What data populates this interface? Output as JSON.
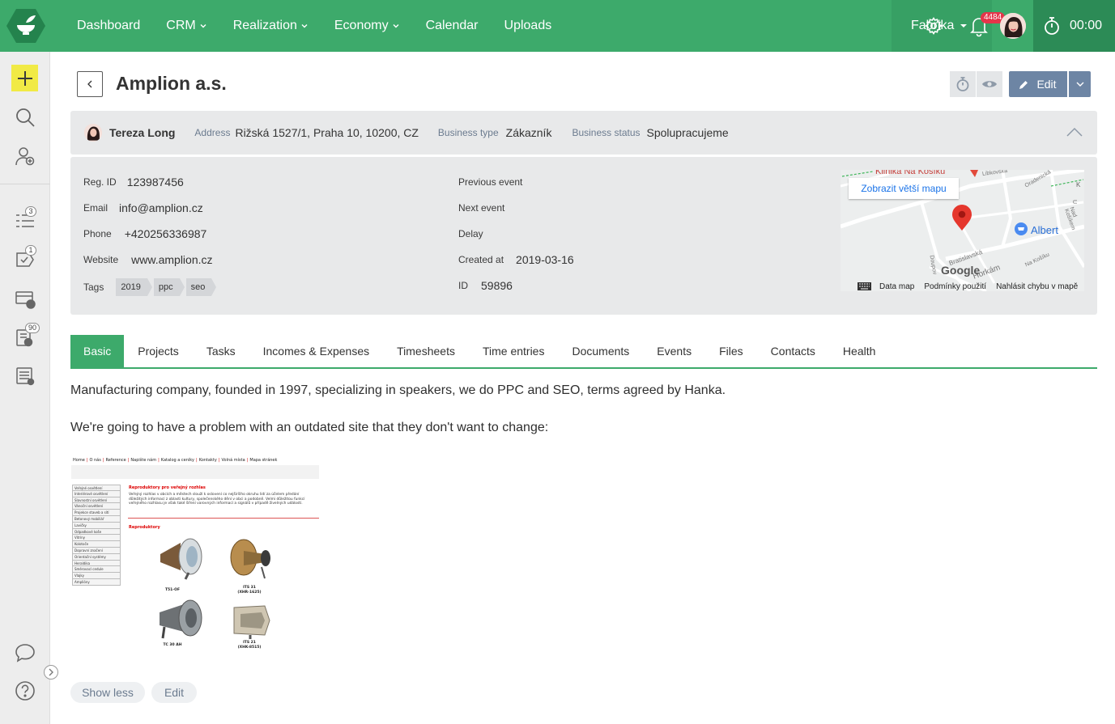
{
  "topbar": {
    "nav": [
      {
        "label": "Dashboard",
        "dropdown": false
      },
      {
        "label": "CRM",
        "dropdown": true
      },
      {
        "label": "Realization",
        "dropdown": true
      },
      {
        "label": "Economy",
        "dropdown": true
      },
      {
        "label": "Calendar",
        "dropdown": false
      },
      {
        "label": "Uploads",
        "dropdown": false
      }
    ],
    "company": "Fabrika",
    "notifications_count": "4484",
    "timer": "00:00"
  },
  "sidebar": {
    "badges": {
      "tasks": "3",
      "approvals": "1",
      "alerts": "90"
    }
  },
  "header": {
    "title": "Amplion a.s.",
    "edit_label": "Edit"
  },
  "summary": {
    "owner": "Tereza Long",
    "address_label": "Address",
    "address": "Rižská 1527/1, Praha 10, 10200, CZ",
    "business_type_label": "Business type",
    "business_type": "Zákazník",
    "business_status_label": "Business status",
    "business_status": "Spolupracujeme"
  },
  "details": {
    "left": {
      "reg_id_label": "Reg. ID",
      "reg_id": "123987456",
      "email_label": "Email",
      "email": "info@amplion.cz",
      "phone_label": "Phone",
      "phone": "+420256336987",
      "website_label": "Website",
      "website": "www.amplion.cz",
      "tags_label": "Tags",
      "tags": [
        "2019",
        "ppc",
        "seo"
      ]
    },
    "right": {
      "previous_event_label": "Previous event",
      "next_event_label": "Next event",
      "delay_label": "Delay",
      "created_at_label": "Created at",
      "created_at": "2019-03-16",
      "id_label": "ID",
      "id": "59896"
    },
    "map": {
      "button": "Zobrazit větší mapu",
      "footer": [
        "Data map",
        "Podmínky použití",
        "Nahlásit chybu v mapě"
      ],
      "places": {
        "top": "Klinika Na Košíku",
        "store": "Albert",
        "street1": "Libkovská",
        "street2": "Oradenická",
        "street3": "Bratislavská",
        "street4": "Na Košíku",
        "street5": "Nad Košíkem",
        "street6": "Horkám",
        "street7": "Doupov",
        "brand": "Google",
        "corner": "K",
        "corner2": "U"
      }
    }
  },
  "tabs": [
    "Basic",
    "Projects",
    "Tasks",
    "Incomes & Expenses",
    "Timesheets",
    "Time entries",
    "Documents",
    "Events",
    "Files",
    "Contacts",
    "Health"
  ],
  "description": {
    "p1": "Manufacturing company, founded in 1997, specializing in speakers, we do PPC and SEO, terms agreed by Hanka.",
    "p2": "We're going to have a problem with an outdated site that they don't want to change:"
  },
  "screenshot": {
    "menu": [
      "Home",
      "O nás",
      "Reference",
      "Napište nám",
      "Katalog a ceníky",
      "Kontakty",
      "Volná místa",
      "Mapa stránek"
    ],
    "side": [
      "Veřejné osvětlení",
      "Interiérové osvětlení",
      "Slavnostní osvětlení",
      "Vánoční osvětlení",
      "Projekce staveb a sítí",
      "Betonový mobiliář",
      "Lavičky",
      "Odpadkové koše",
      "Vitríny",
      "Kolotoče",
      "Dopravní značení",
      "Orientační systémy",
      "Heraldika",
      "Směrovací cedule",
      "Vlajky",
      "Amplióny"
    ],
    "heading": "Reproduktory pro veřejný rozhlas",
    "paragraph": "Veřejný rozhlas v obcích a městech slouží k oslovení co nejširšího okruhu lidí za účelem předání důležitých informací z oblasti kultury, společenského dění v obci a podobně. Velmi důležitou funkcí veřejného rozhlasu je však také šíření varovných informací a signálů v případě živelných událostí.",
    "section": "Reproduktory",
    "products": [
      {
        "name": "T51-OF",
        "code": ""
      },
      {
        "name": "ITS 31",
        "code": "(XHR-1625)"
      },
      {
        "name": "TC 30 AH",
        "code": ""
      },
      {
        "name": "ITS 21",
        "code": "(XHK-8515)"
      }
    ]
  },
  "actions": {
    "show_less": "Show less",
    "edit": "Edit"
  }
}
